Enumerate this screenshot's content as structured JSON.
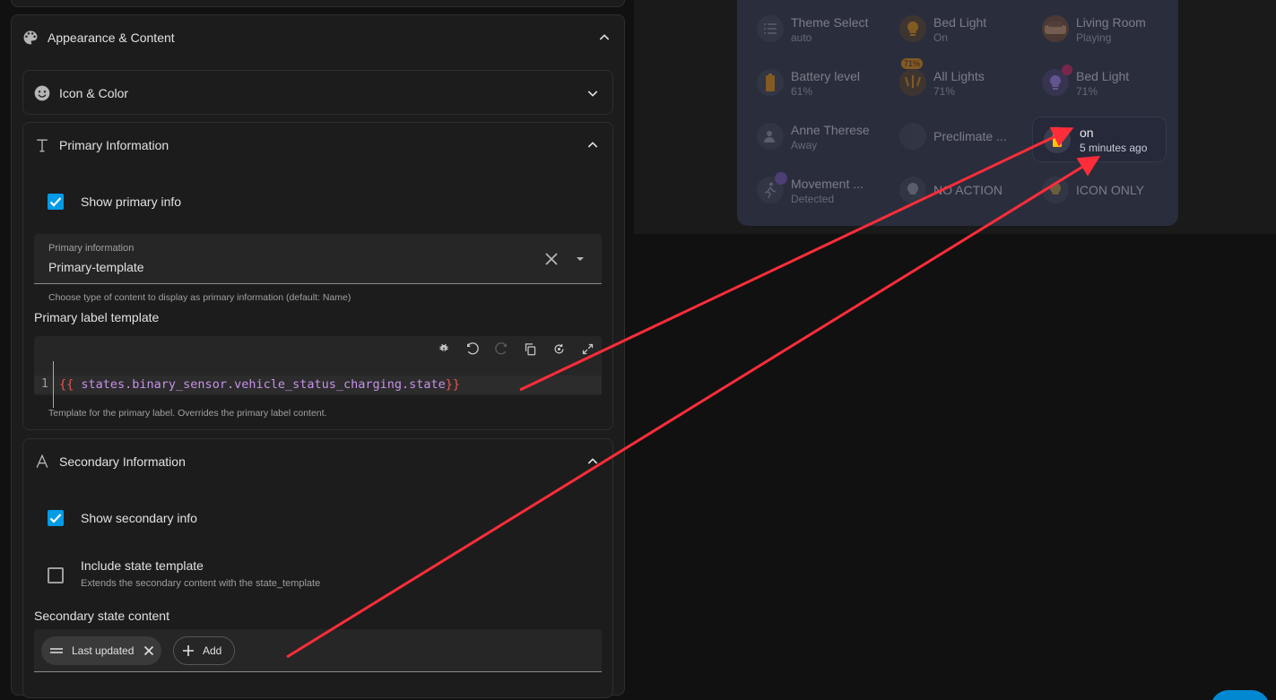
{
  "appearance": {
    "title": "Appearance & Content"
  },
  "icon_color": {
    "title": "Icon & Color"
  },
  "primary": {
    "title": "Primary Information",
    "show_label": "Show primary info",
    "show_checked": true,
    "field_label": "Primary information",
    "field_value": "Primary-template",
    "field_helper": "Choose type of content to display as primary information (default: Name)",
    "template_label": "Primary label template",
    "line_number": "1",
    "code_open": "{{ ",
    "code_expr": "states.binary_sensor.vehicle_status_charging.state",
    "code_close": "}}",
    "template_helper": "Template for the primary label. Overrides the primary label content."
  },
  "secondary": {
    "title": "Secondary Information",
    "show_label": "Show secondary info",
    "show_checked": true,
    "include_label": "Include state template",
    "include_sub": "Extends the secondary content with the state_template",
    "include_checked": false,
    "content_label": "Secondary state content",
    "chips": [
      {
        "label": "Last updated"
      }
    ],
    "add_label": "Add"
  },
  "preview": {
    "tiles": [
      {
        "name": "Theme Select",
        "state": "auto",
        "icon": "list-icon"
      },
      {
        "name": "Bed Light",
        "state": "On",
        "icon": "bulb-icon"
      },
      {
        "name": "Living Room",
        "state": "Playing",
        "icon": "album-art-icon"
      },
      {
        "name": "Battery level",
        "state": "61%",
        "icon": "battery-icon"
      },
      {
        "name": "All Lights",
        "state": "71%",
        "icon": "lights-group-icon",
        "badge": "71%"
      },
      {
        "name": "Bed Light",
        "state": "71%",
        "icon": "bulb-icon"
      },
      {
        "name": "Anne Therese",
        "state": "Away",
        "icon": "person-away-icon"
      },
      {
        "name": "Preclimate ...",
        "state": "",
        "icon": "climate-icon"
      },
      {
        "name": "on",
        "state": "5 minutes ago",
        "icon": "charging-icon",
        "active": true
      },
      {
        "name": "Movement ...",
        "state": "Detected",
        "icon": "motion-icon"
      },
      {
        "name": "NO ACTION",
        "state": "",
        "icon": "bulb-icon"
      },
      {
        "name": "ICON ONLY",
        "state": "",
        "icon": "bulb-icon"
      }
    ]
  },
  "colors": {
    "accent": "#039be5",
    "arrow": "#ff2d3a",
    "panel": "#1c1c1c",
    "card": "#2a2d3c"
  }
}
